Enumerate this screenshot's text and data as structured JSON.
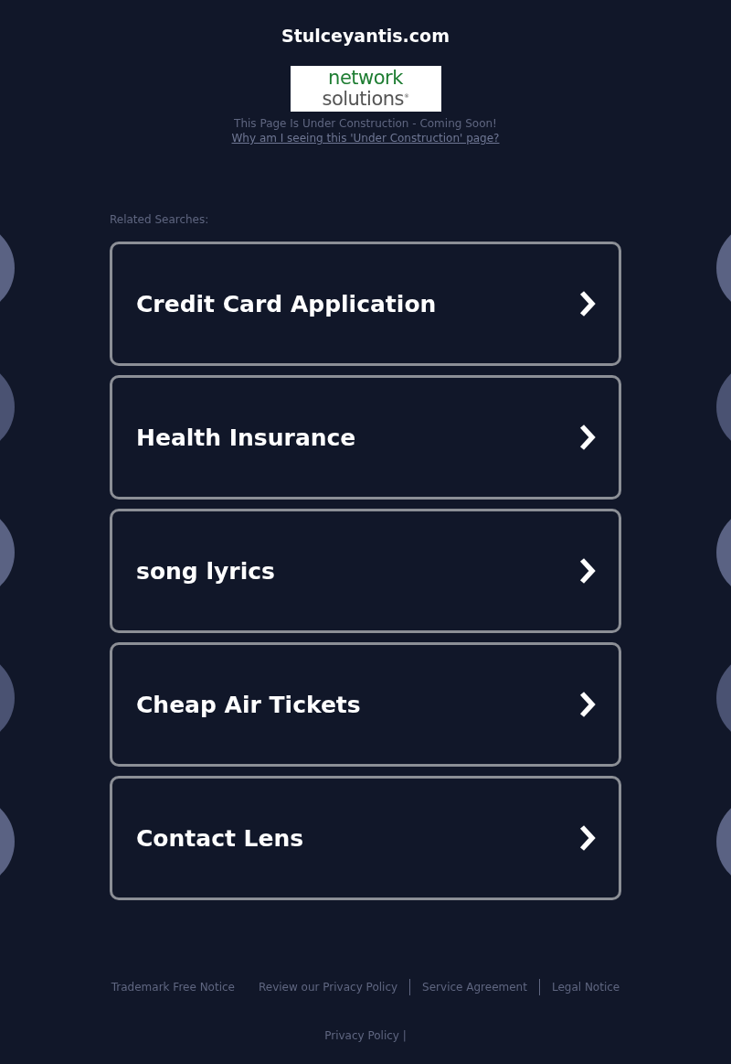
{
  "site_title": "Stulceyantis.com",
  "logo": {
    "line_1": "network",
    "line_2": "solutions",
    "mark": "®"
  },
  "notice": "This Page Is Under Construction - Coming Soon!",
  "notice_link": "Why am I seeing this 'Under Construction' page?",
  "related_label": "Related Searches:",
  "searches": [
    {
      "label": "Credit Card Application"
    },
    {
      "label": "Health Insurance"
    },
    {
      "label": "song lyrics"
    },
    {
      "label": "Cheap Air Tickets"
    },
    {
      "label": "Contact Lens"
    }
  ],
  "footer_links": [
    {
      "label": "Trademark Free Notice",
      "separator": false
    },
    {
      "label": "Review our Privacy Policy",
      "separator": true
    },
    {
      "label": "Service Agreement",
      "separator": true
    },
    {
      "label": "Legal Notice",
      "separator": false
    }
  ],
  "bottom_link": "Privacy Policy |"
}
